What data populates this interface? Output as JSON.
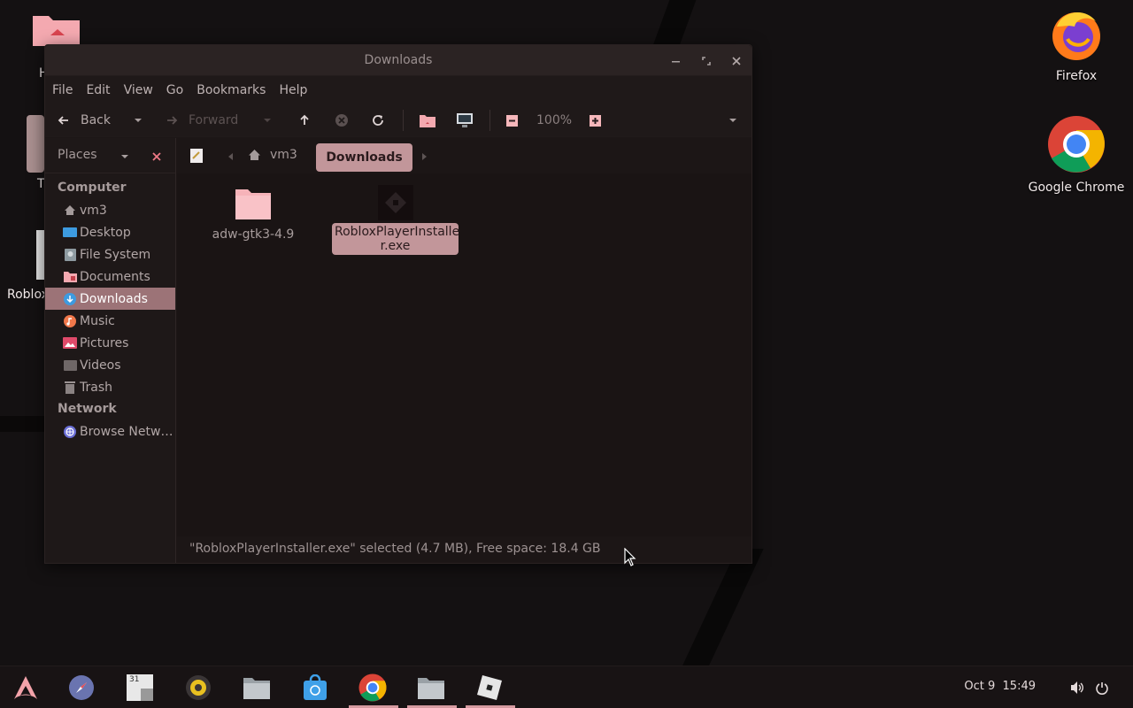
{
  "desktop": {
    "icons": [
      {
        "label": "Firefox"
      },
      {
        "label": "Google Chrome"
      }
    ],
    "partial_labels": [
      "H",
      "T",
      "Roblox"
    ]
  },
  "window": {
    "title": "Downloads",
    "menu": [
      "File",
      "Edit",
      "View",
      "Go",
      "Bookmarks",
      "Help"
    ],
    "toolbar": {
      "back": "Back",
      "forward": "Forward",
      "zoom": "100%"
    },
    "places_label": "Places",
    "breadcrumb": {
      "home": "vm3",
      "current": "Downloads"
    },
    "sidebar": {
      "computer_header": "Computer",
      "items": [
        {
          "label": "vm3",
          "icon": "home-icon"
        },
        {
          "label": "Desktop",
          "icon": "desktop-icon"
        },
        {
          "label": "File System",
          "icon": "drive-icon"
        },
        {
          "label": "Documents",
          "icon": "folder-icon"
        },
        {
          "label": "Downloads",
          "icon": "download-icon"
        },
        {
          "label": "Music",
          "icon": "music-icon"
        },
        {
          "label": "Pictures",
          "icon": "pictures-icon"
        },
        {
          "label": "Videos",
          "icon": "videos-icon"
        },
        {
          "label": "Trash",
          "icon": "trash-icon"
        }
      ],
      "network_header": "Network",
      "network_items": [
        {
          "label": "Browse Netw…",
          "icon": "network-icon"
        }
      ]
    },
    "files": [
      {
        "name": "adw-gtk3-4.9",
        "type": "folder"
      },
      {
        "name_line1": "RobloxPlayerInstalle",
        "name_line2": "r.exe",
        "type": "exe",
        "selected": true
      }
    ],
    "status": "\"RobloxPlayerInstaller.exe\" selected (4.7 MB), Free space: 18.4 GB"
  },
  "taskbar": {
    "date": "Oct 9",
    "time": "15:49",
    "calendar_day": "31"
  },
  "colors": {
    "accent": "#c2969a",
    "sidebar_active": "#9c7377",
    "folder": "#f5b3b8"
  }
}
